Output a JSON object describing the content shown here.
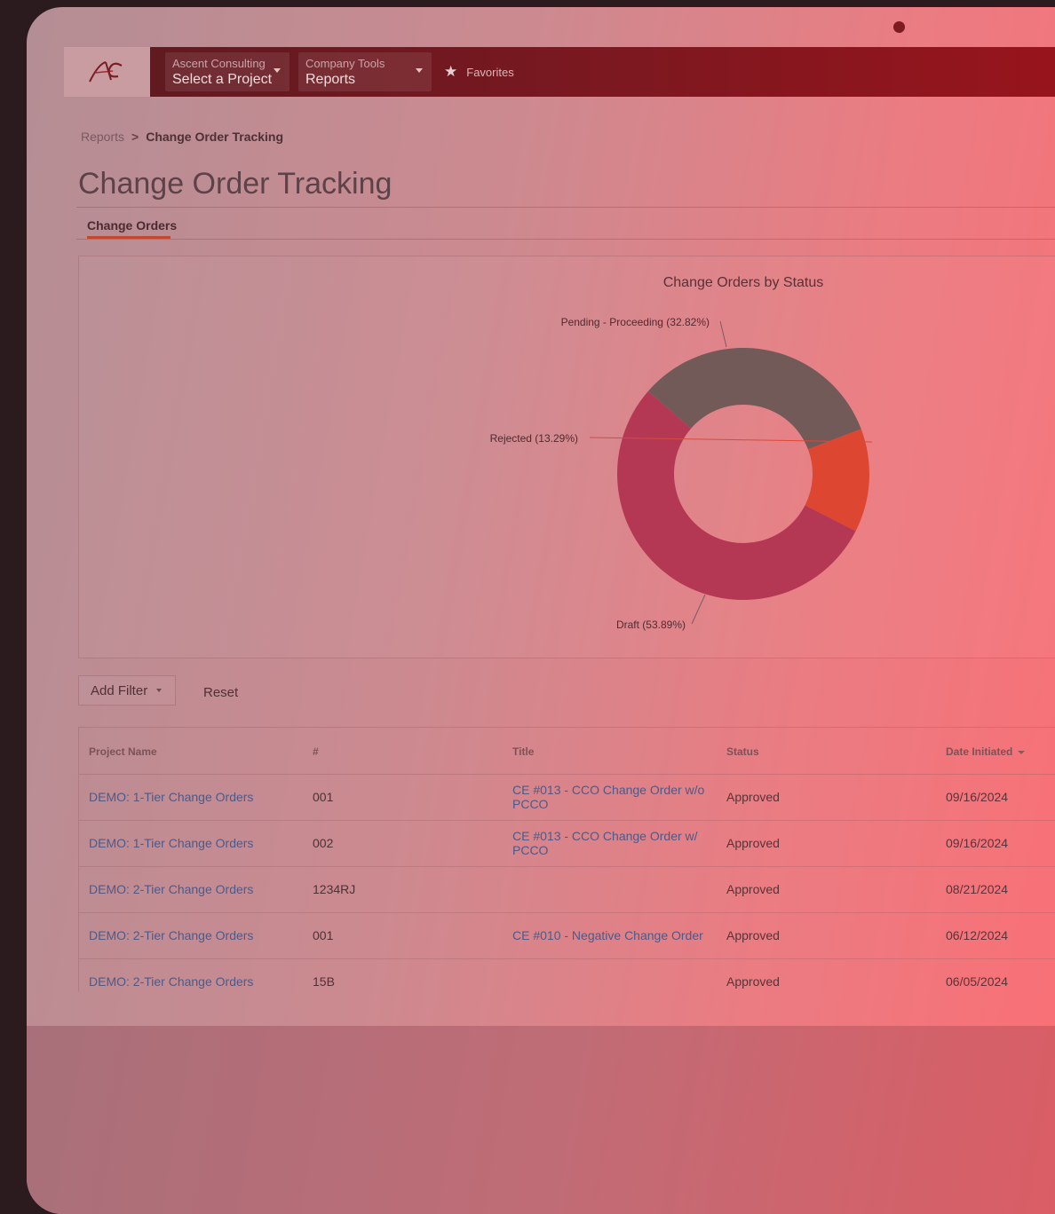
{
  "topbar": {
    "logo_text": "AC",
    "company": {
      "label": "Ascent Consulting",
      "value": "Select a Project"
    },
    "tools": {
      "label": "Company Tools",
      "value": "Reports"
    },
    "favorites_label": "Favorites",
    "icons": {
      "favorites": "star-icon",
      "dropdown": "caret-down-icon"
    }
  },
  "breadcrumb": {
    "parent": "Reports",
    "current": "Change Order Tracking"
  },
  "page_title": "Change Order Tracking",
  "tabs": [
    {
      "label": "Change Orders",
      "active": true
    }
  ],
  "chart_data": {
    "type": "pie",
    "title": "Change Orders by Status",
    "donut": true,
    "slices": [
      {
        "label": "Pending - Proceeding (32.82%)",
        "category": "Pending - Proceeding",
        "value": 32.82,
        "color": "#725a59"
      },
      {
        "label": "Rejected (13.29%)",
        "category": "Rejected",
        "value": 13.29,
        "color": "#dd4630"
      },
      {
        "label": "Draft (53.89%)",
        "category": "Draft",
        "value": 53.89,
        "color": "#b43854"
      }
    ]
  },
  "filters": {
    "add_filter": "Add Filter",
    "reset": "Reset"
  },
  "table": {
    "columns": {
      "project": "Project Name",
      "number": "#",
      "title": "Title",
      "status": "Status",
      "date": "Date Initiated"
    },
    "rows": [
      {
        "project": "DEMO: 1-Tier Change Orders",
        "number": "001",
        "title": "CE #013 - CCO Change Order w/o PCCO",
        "status": "Approved",
        "date": "09/16/2024"
      },
      {
        "project": "DEMO: 1-Tier Change Orders",
        "number": "002",
        "title": "CE #013 - CCO Change Order w/ PCCO",
        "status": "Approved",
        "date": "09/16/2024"
      },
      {
        "project": "DEMO: 2-Tier Change Orders",
        "number": "1234RJ",
        "title": "",
        "status": "Approved",
        "date": "08/21/2024"
      },
      {
        "project": "DEMO: 2-Tier Change Orders",
        "number": "001",
        "title": "CE #010 - Negative Change Order",
        "status": "Approved",
        "date": "06/12/2024"
      },
      {
        "project": "DEMO: 2-Tier Change Orders",
        "number": "15B",
        "title": "",
        "status": "Approved",
        "date": "06/05/2024"
      }
    ]
  }
}
